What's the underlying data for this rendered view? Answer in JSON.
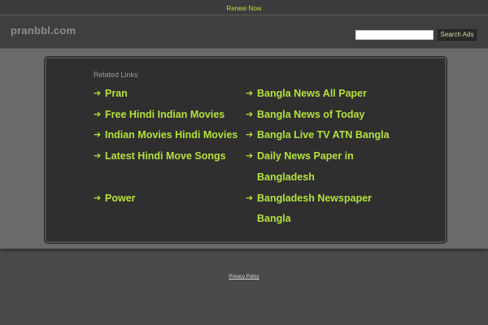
{
  "topbar": {
    "renew_label": "Renew Now"
  },
  "header": {
    "logo": "pranbbl.com",
    "search_value": "",
    "search_button": "Search Ads"
  },
  "related": {
    "title": "Related Links",
    "left": [
      "Pran",
      "Free Hindi Indian Movies",
      "Indian Movies Hindi Movies",
      "Latest Hindi Move Songs",
      "Power"
    ],
    "right": [
      "Bangla News All Paper",
      "Bangla News of Today",
      "Bangla Live TV ATN Bangla",
      "Daily News Paper in Bangladesh",
      "Bangladesh Newspaper Bangla"
    ]
  },
  "footer": {
    "privacy_label": "Privacy Policy"
  },
  "colors": {
    "accent": "#b4e23c",
    "background": "#4a4a4a",
    "panel": "#2f2f2f"
  },
  "icons": {
    "link_arrow": "right-arrow-icon"
  }
}
